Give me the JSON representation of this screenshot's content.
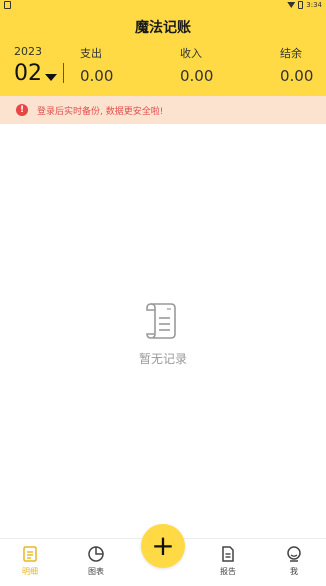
{
  "status_bar": {
    "time": "3:34"
  },
  "app": {
    "title": "魔法记账"
  },
  "period": {
    "year": "2023",
    "month": "02"
  },
  "summary": {
    "expense_label": "支出",
    "expense_value": "0.00",
    "income_label": "收入",
    "income_value": "0.00",
    "balance_label": "结余",
    "balance_value": "0.00"
  },
  "banner": {
    "text": "登录后实时备份, 数据更安全啦!"
  },
  "empty_state": {
    "text": "暂无记录"
  },
  "tabs": [
    {
      "label": "明细",
      "icon": "detail-icon",
      "active": true
    },
    {
      "label": "图表",
      "icon": "chart-icon",
      "active": false
    },
    {
      "label": "报告",
      "icon": "report-icon",
      "active": false
    },
    {
      "label": "我",
      "icon": "profile-icon",
      "active": false
    }
  ],
  "fab": {
    "label": "+"
  },
  "colors": {
    "accent": "#FFDA44",
    "warning": "#E84545",
    "banner_bg": "#FCE3CF",
    "active_tab": "#E8B520"
  }
}
